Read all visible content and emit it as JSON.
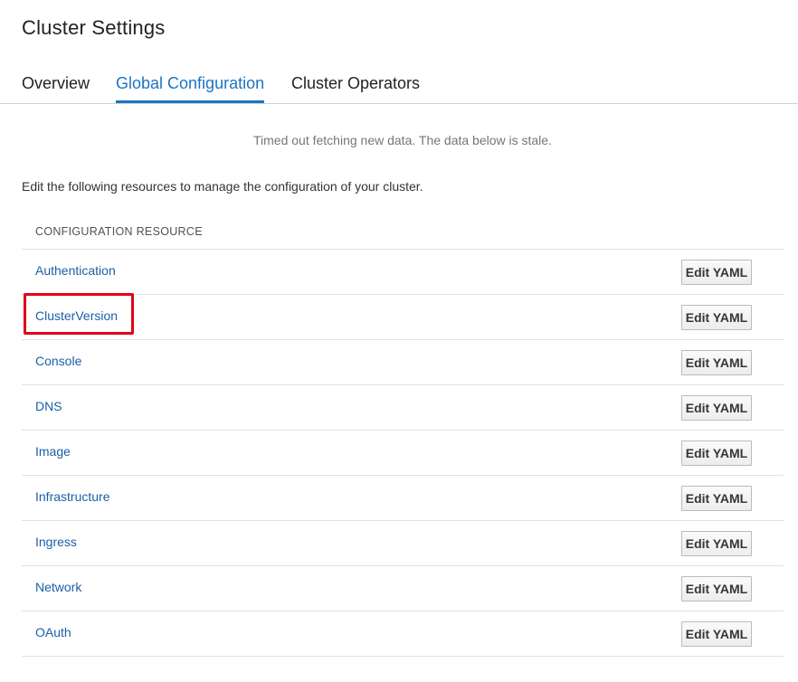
{
  "page": {
    "title": "Cluster Settings"
  },
  "tabs": [
    {
      "label": "Overview",
      "active": false
    },
    {
      "label": "Global Configuration",
      "active": true
    },
    {
      "label": "Cluster Operators",
      "active": false
    }
  ],
  "notice": "Timed out fetching new data. The data below is stale.",
  "description": "Edit the following resources to manage the configuration of your cluster.",
  "table": {
    "header": "CONFIGURATION RESOURCE",
    "rows": [
      {
        "name": "Authentication",
        "action": "Edit YAML"
      },
      {
        "name": "ClusterVersion",
        "action": "Edit YAML"
      },
      {
        "name": "Console",
        "action": "Edit YAML"
      },
      {
        "name": "DNS",
        "action": "Edit YAML"
      },
      {
        "name": "Image",
        "action": "Edit YAML"
      },
      {
        "name": "Infrastructure",
        "action": "Edit YAML"
      },
      {
        "name": "Ingress",
        "action": "Edit YAML"
      },
      {
        "name": "Network",
        "action": "Edit YAML"
      },
      {
        "name": "OAuth",
        "action": "Edit YAML"
      }
    ]
  },
  "colors": {
    "accent": "#1b74c4",
    "link": "#1b5fa8",
    "highlight": "#e0001a"
  }
}
